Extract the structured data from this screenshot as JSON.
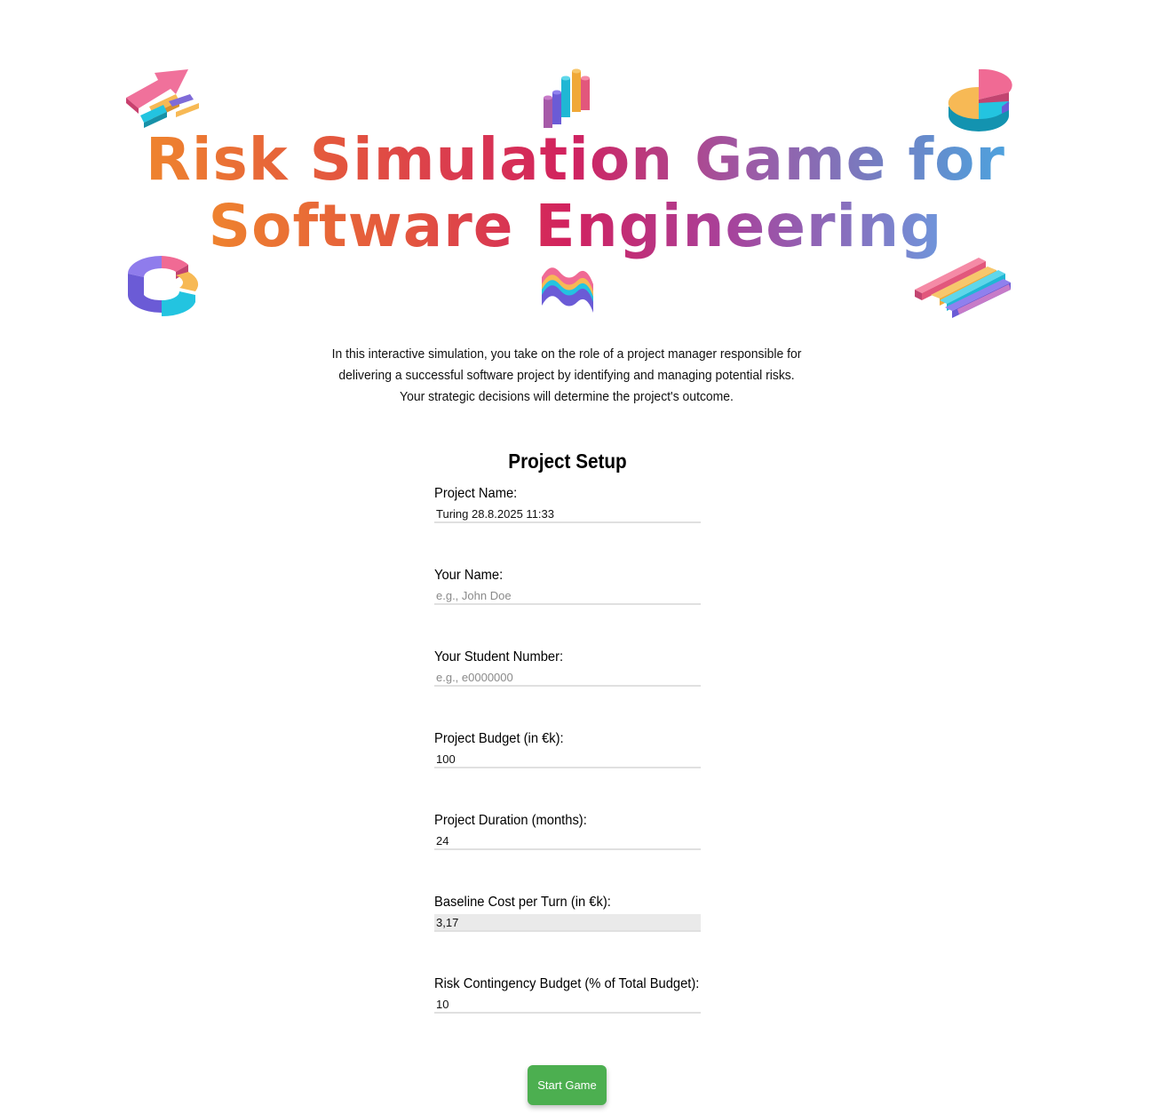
{
  "hero": {
    "title_line1": "Risk Simulation Game for",
    "title_line2": "Software Engineering",
    "decorations": [
      "arrows-icon",
      "bar-chart-icon",
      "pie-chart-icon",
      "donut-chart-icon",
      "wave-chart-icon",
      "stacked-bars-icon"
    ]
  },
  "intro": {
    "text": "In this interactive simulation, you take on the role of a project manager responsible for delivering a successful software project by identifying and managing potential risks. Your strategic decisions will determine the project's outcome."
  },
  "setup": {
    "title": "Project Setup",
    "fields": [
      {
        "label": "Project Name:",
        "value": "Turing 28.8.2025 11:33",
        "placeholder": ""
      },
      {
        "label": "Your Name:",
        "value": "",
        "placeholder": "e.g., John Doe"
      },
      {
        "label": "Your Student Number:",
        "value": "",
        "placeholder": "e.g., e0000000"
      },
      {
        "label": "Project Budget (in €k):",
        "value": "100",
        "placeholder": ""
      },
      {
        "label": "Project Duration (months):",
        "value": "24",
        "placeholder": ""
      },
      {
        "label": "Baseline Cost per Turn (in €k):",
        "value": "3,17",
        "placeholder": ""
      },
      {
        "label": "Risk Contingency Budget (% of Total Budget):",
        "value": "10",
        "placeholder": ""
      }
    ]
  },
  "actions": {
    "start_label": "Start Game"
  },
  "colors": {
    "accent_green": "#4caf50",
    "title_orange": "#f08a2c",
    "title_pink": "#d1215f",
    "title_blue": "#4aa5e0"
  }
}
